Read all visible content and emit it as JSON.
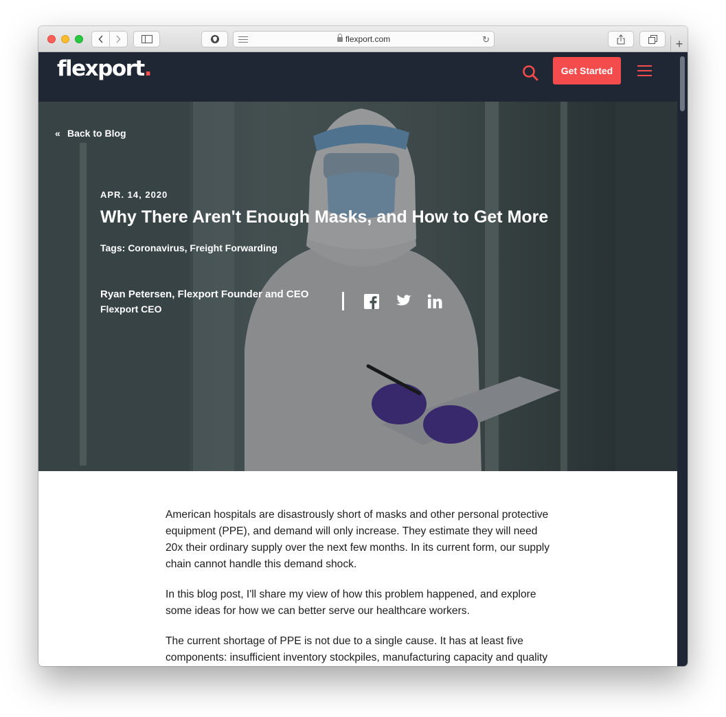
{
  "browser": {
    "url": "flexport.com"
  },
  "site": {
    "logo_text": "flexport",
    "logo_dot": ".",
    "cta_label": "Get Started",
    "accent_color": "#f44c4c",
    "header_bg": "#1e2733"
  },
  "hero": {
    "back_label": "Back to Blog",
    "date": "APR. 14, 2020",
    "title": "Why There Aren't Enough Masks, and How to Get More",
    "tags": "Tags: Coronavirus, Freight Forwarding",
    "author": "Ryan Petersen, Flexport Founder and CEO",
    "author_role": "Flexport CEO",
    "social_icons": [
      "facebook-icon",
      "twitter-icon",
      "linkedin-icon"
    ]
  },
  "article": {
    "paragraphs": [
      "American hospitals are disastrously short of masks and other personal protective equipment (PPE), and demand will only increase. They estimate they will need 20x their ordinary supply over the next few months. In its current form, our supply chain cannot handle this demand shock.",
      "In this blog post, I'll share my view of how this problem happened, and explore some ideas for how we can better serve our healthcare workers.",
      "The current shortage of PPE is not due to a single cause. It has at least five components: insufficient inventory stockpiles, manufacturing capacity and quality control, international trade compliance, air uplift capacity, and working capital financing. And if we don't plan ahead, we'll have a sixth"
    ]
  }
}
